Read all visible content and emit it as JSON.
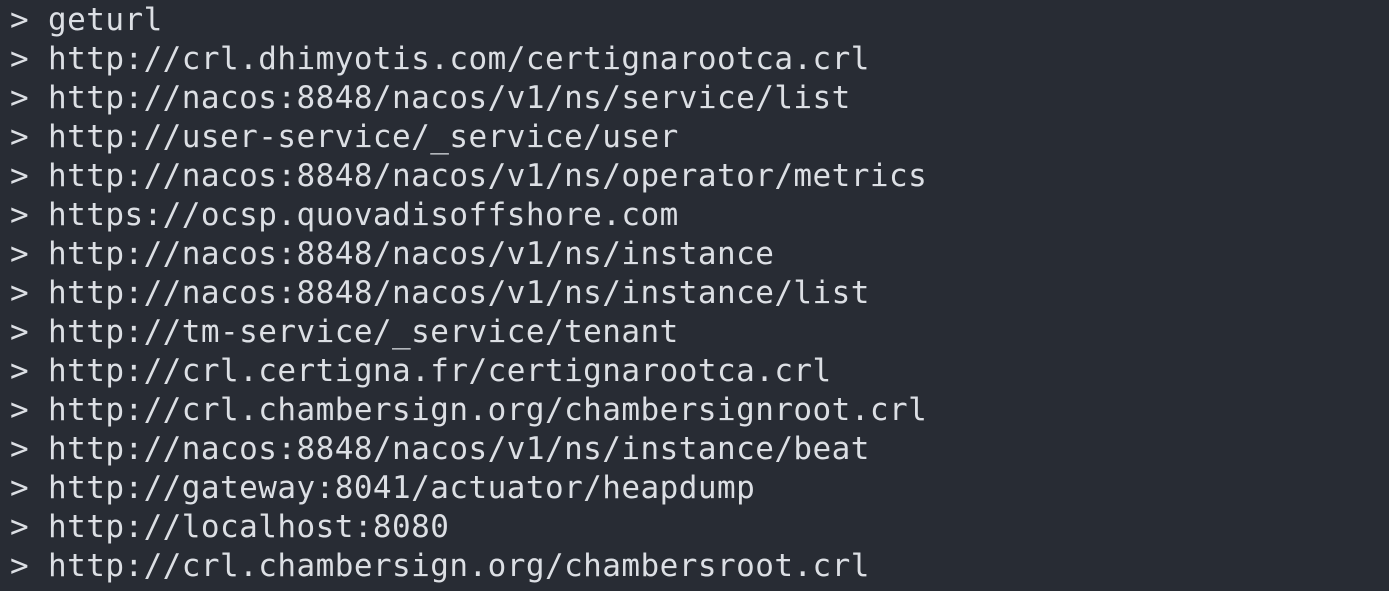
{
  "terminal": {
    "prompt_symbol": ">",
    "lines": [
      "geturl",
      "http://crl.dhimyotis.com/certignarootca.crl",
      "http://nacos:8848/nacos/v1/ns/service/list",
      "http://user-service/_service/user",
      "http://nacos:8848/nacos/v1/ns/operator/metrics",
      "https://ocsp.quovadisoffshore.com",
      "http://nacos:8848/nacos/v1/ns/instance",
      "http://nacos:8848/nacos/v1/ns/instance/list",
      "http://tm-service/_service/tenant",
      "http://crl.certigna.fr/certignarootca.crl",
      "http://crl.chambersign.org/chambersignroot.crl",
      "http://nacos:8848/nacos/v1/ns/instance/beat",
      "http://gateway:8041/actuator/heapdump",
      "http://localhost:8080",
      "http://crl.chambersign.org/chambersroot.crl"
    ]
  },
  "colors": {
    "background": "#282c34",
    "text": "#dcdfe4"
  }
}
